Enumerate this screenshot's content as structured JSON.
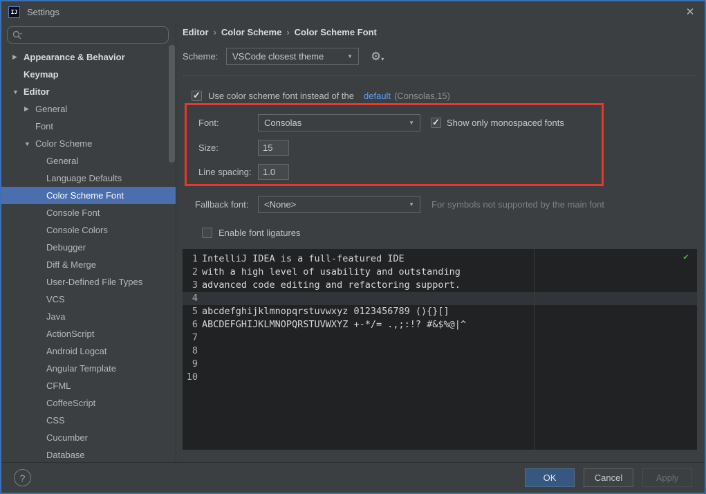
{
  "window": {
    "title": "Settings",
    "close_glyph": "✕",
    "icon_text": "IJ"
  },
  "search": {
    "placeholder": ""
  },
  "sidebar": {
    "items": [
      {
        "label": "Appearance & Behavior",
        "level": 0,
        "arrow": "right",
        "bold": true,
        "selected": false
      },
      {
        "label": "Keymap",
        "level": 0,
        "arrow": null,
        "bold": true,
        "selected": false
      },
      {
        "label": "Editor",
        "level": 0,
        "arrow": "down",
        "bold": true,
        "selected": false
      },
      {
        "label": "General",
        "level": 1,
        "arrow": "right",
        "bold": false,
        "selected": false
      },
      {
        "label": "Font",
        "level": 1,
        "arrow": null,
        "bold": false,
        "selected": false
      },
      {
        "label": "Color Scheme",
        "level": 1,
        "arrow": "down",
        "bold": false,
        "selected": false
      },
      {
        "label": "General",
        "level": 2,
        "arrow": null,
        "bold": false,
        "selected": false
      },
      {
        "label": "Language Defaults",
        "level": 2,
        "arrow": null,
        "bold": false,
        "selected": false
      },
      {
        "label": "Color Scheme Font",
        "level": 2,
        "arrow": null,
        "bold": false,
        "selected": true
      },
      {
        "label": "Console Font",
        "level": 2,
        "arrow": null,
        "bold": false,
        "selected": false
      },
      {
        "label": "Console Colors",
        "level": 2,
        "arrow": null,
        "bold": false,
        "selected": false
      },
      {
        "label": "Debugger",
        "level": 2,
        "arrow": null,
        "bold": false,
        "selected": false
      },
      {
        "label": "Diff & Merge",
        "level": 2,
        "arrow": null,
        "bold": false,
        "selected": false
      },
      {
        "label": "User-Defined File Types",
        "level": 2,
        "arrow": null,
        "bold": false,
        "selected": false
      },
      {
        "label": "VCS",
        "level": 2,
        "arrow": null,
        "bold": false,
        "selected": false
      },
      {
        "label": "Java",
        "level": 2,
        "arrow": null,
        "bold": false,
        "selected": false
      },
      {
        "label": "ActionScript",
        "level": 2,
        "arrow": null,
        "bold": false,
        "selected": false
      },
      {
        "label": "Android Logcat",
        "level": 2,
        "arrow": null,
        "bold": false,
        "selected": false
      },
      {
        "label": "Angular Template",
        "level": 2,
        "arrow": null,
        "bold": false,
        "selected": false
      },
      {
        "label": "CFML",
        "level": 2,
        "arrow": null,
        "bold": false,
        "selected": false
      },
      {
        "label": "CoffeeScript",
        "level": 2,
        "arrow": null,
        "bold": false,
        "selected": false
      },
      {
        "label": "CSS",
        "level": 2,
        "arrow": null,
        "bold": false,
        "selected": false
      },
      {
        "label": "Cucumber",
        "level": 2,
        "arrow": null,
        "bold": false,
        "selected": false
      },
      {
        "label": "Database",
        "level": 2,
        "arrow": null,
        "bold": false,
        "selected": false
      }
    ],
    "help_glyph": "?"
  },
  "breadcrumb": {
    "parts": [
      "Editor",
      "Color Scheme",
      "Color Scheme Font"
    ],
    "separator": "›"
  },
  "scheme": {
    "label": "Scheme:",
    "value": "VSCode closest theme",
    "gear_glyph": "⚙",
    "gear_arrow": "▾"
  },
  "use_font": {
    "checked": true,
    "label": "Use color scheme font instead of the",
    "link": "default",
    "suffix": "(Consolas,15)"
  },
  "font_section": {
    "font_label": "Font:",
    "font_value": "Consolas",
    "mono_label": "Show only monospaced fonts",
    "mono_checked": true,
    "size_label": "Size:",
    "size_value": "15",
    "line_spacing_label": "Line spacing:",
    "line_spacing_value": "1.0"
  },
  "fallback": {
    "label": "Fallback font:",
    "value": "<None>",
    "hint": "For symbols not supported by the main font"
  },
  "ligatures": {
    "label": "Enable font ligatures",
    "checked": false
  },
  "preview": {
    "highlight_line": 4,
    "ok_glyph": "✔",
    "lines": [
      {
        "num": "1",
        "text": "IntelliJ IDEA is a full-featured IDE"
      },
      {
        "num": "2",
        "text": "with a high level of usability and outstanding"
      },
      {
        "num": "3",
        "text": "advanced code editing and refactoring support."
      },
      {
        "num": "4",
        "text": ""
      },
      {
        "num": "5",
        "text": "abcdefghijklmnopqrstuvwxyz 0123456789 (){}[]"
      },
      {
        "num": "6",
        "text": "ABCDEFGHIJKLMNOPQRSTUVWXYZ +-*/= .,;:!? #&$%@|^"
      },
      {
        "num": "7",
        "text": ""
      },
      {
        "num": "8",
        "text": ""
      },
      {
        "num": "9",
        "text": ""
      },
      {
        "num": "10",
        "text": ""
      }
    ]
  },
  "buttons": {
    "ok": "OK",
    "cancel": "Cancel",
    "apply": "Apply"
  },
  "colors": {
    "selection_blue": "#4b6eaf",
    "link_blue": "#5a9df5",
    "annotation_red": "#e8382a",
    "ok_button": "#365880",
    "editor_bg": "#202223",
    "caret_line": "#313539",
    "check_green": "#51a552",
    "window_border": "#3d6fb4",
    "panel_bg": "#3c3f41"
  }
}
